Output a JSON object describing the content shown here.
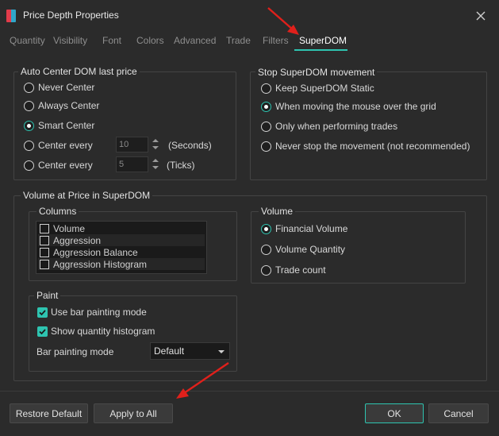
{
  "window": {
    "title": "Price Depth Properties"
  },
  "tabs": [
    {
      "label": "Quantity"
    },
    {
      "label": "Visibility"
    },
    {
      "label": "Font"
    },
    {
      "label": "Colors"
    },
    {
      "label": "Advanced"
    },
    {
      "label": "Trade"
    },
    {
      "label": "Filters"
    },
    {
      "label": "SuperDOM",
      "active": true
    }
  ],
  "auto_center": {
    "title": "Auto Center DOM last price",
    "options": [
      {
        "label": "Never Center",
        "checked": false
      },
      {
        "label": "Always Center",
        "checked": false
      },
      {
        "label": "Smart Center",
        "checked": true
      },
      {
        "label": "Center every",
        "checked": false,
        "value": "10",
        "unit": "(Seconds)"
      },
      {
        "label": "Center every",
        "checked": false,
        "value": "5",
        "unit": "(Ticks)"
      }
    ]
  },
  "stop_movement": {
    "title": "Stop SuperDOM movement",
    "options": [
      {
        "label": "Keep SuperDOM Static",
        "checked": false
      },
      {
        "label": "When moving the mouse over the grid",
        "checked": true
      },
      {
        "label": "Only when performing trades",
        "checked": false
      },
      {
        "label": "Never stop the movement (not recommended)",
        "checked": false
      }
    ]
  },
  "volume_at_price": {
    "title": "Volume at Price in SuperDOM",
    "columns": {
      "title": "Columns",
      "items": [
        {
          "label": "Volume",
          "checked": false
        },
        {
          "label": "Aggression",
          "checked": false
        },
        {
          "label": "Aggression Balance",
          "checked": false
        },
        {
          "label": "Aggression Histogram",
          "checked": false
        }
      ]
    },
    "volume": {
      "title": "Volume",
      "options": [
        {
          "label": "Financial Volume",
          "checked": true
        },
        {
          "label": "Volume Quantity",
          "checked": false
        },
        {
          "label": "Trade count",
          "checked": false
        }
      ]
    },
    "paint": {
      "title": "Paint",
      "use_bar_painting": {
        "label": "Use bar painting mode",
        "checked": true
      },
      "show_histogram": {
        "label": "Show quantity histogram",
        "checked": true
      },
      "mode_label": "Bar painting mode",
      "mode_value": "Default"
    }
  },
  "footer": {
    "restore_default": "Restore Default",
    "apply_to_all": "Apply to All",
    "ok": "OK",
    "cancel": "Cancel"
  },
  "colors": {
    "accent": "#2ec4b0",
    "background": "#2b2b2b",
    "annotation_arrow": "#e0201b"
  }
}
